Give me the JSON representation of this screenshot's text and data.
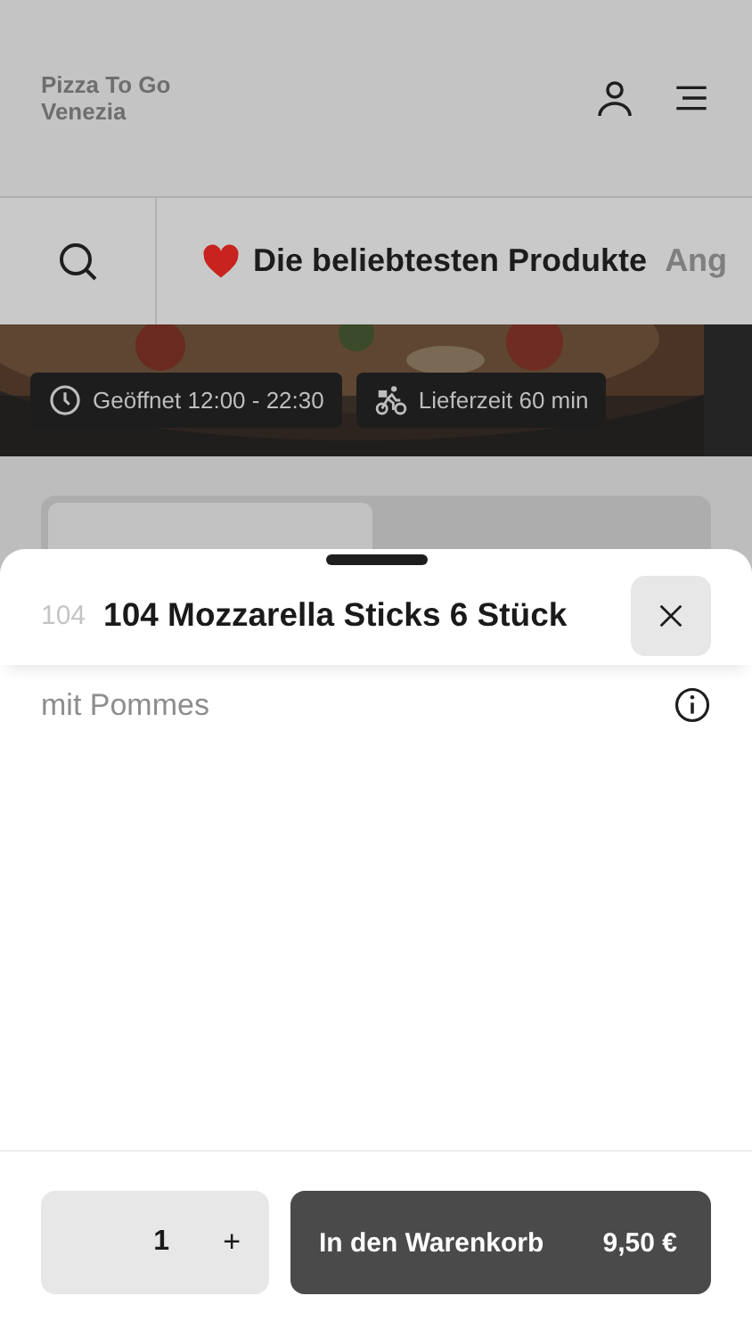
{
  "header": {
    "logo": "Pizza To Go Venezia"
  },
  "category_bar": {
    "categories": [
      {
        "label": "Die beliebtesten Produkte",
        "selected": true,
        "kind": "favorite"
      },
      {
        "label": "Ang",
        "selected": false,
        "kind": "plain"
      }
    ]
  },
  "hero": {
    "badges": [
      {
        "kind": "clock",
        "text": "Geöffnet 12:00 - 22:30"
      },
      {
        "kind": "bike",
        "text": "Lieferzeit 60 min"
      }
    ]
  },
  "order_mode": {
    "tabs": [
      {
        "selected": true
      },
      {
        "selected": false
      }
    ]
  },
  "sheet": {
    "number": "104",
    "title": "104 Mozzarella Sticks 6 Stück",
    "description": "mit Pommes",
    "quantity": "1",
    "increment": "+",
    "add_button": {
      "label": "In den Warenkorb",
      "price": "9,50 €"
    }
  }
}
